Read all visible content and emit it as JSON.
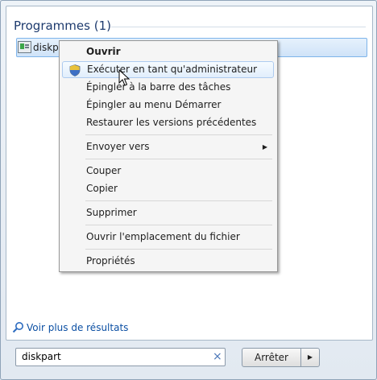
{
  "results": {
    "section_title": "Programmes (1)",
    "items": [
      {
        "label": "diskp"
      }
    ]
  },
  "context_menu": {
    "items": [
      {
        "label": "Ouvrir"
      },
      {
        "label": "Exécuter en tant qu'administrateur"
      },
      {
        "label": "Épingler à la barre des tâches"
      },
      {
        "label": "Épingler au menu Démarrer"
      },
      {
        "label": "Restaurer les versions précédentes"
      },
      {
        "label": "Envoyer vers"
      },
      {
        "label": "Couper"
      },
      {
        "label": "Copier"
      },
      {
        "label": "Supprimer"
      },
      {
        "label": "Ouvrir l'emplacement du fichier"
      },
      {
        "label": "Propriétés"
      }
    ]
  },
  "footer": {
    "more_results": "Voir plus de résultats",
    "search_value": "diskpart",
    "stop_button": "Arrêter"
  },
  "colors": {
    "title_text": "#1e3b6e",
    "link_text": "#0b4fa3",
    "selection": "#cfe3f8",
    "menu_background": "#f5f5f5"
  }
}
